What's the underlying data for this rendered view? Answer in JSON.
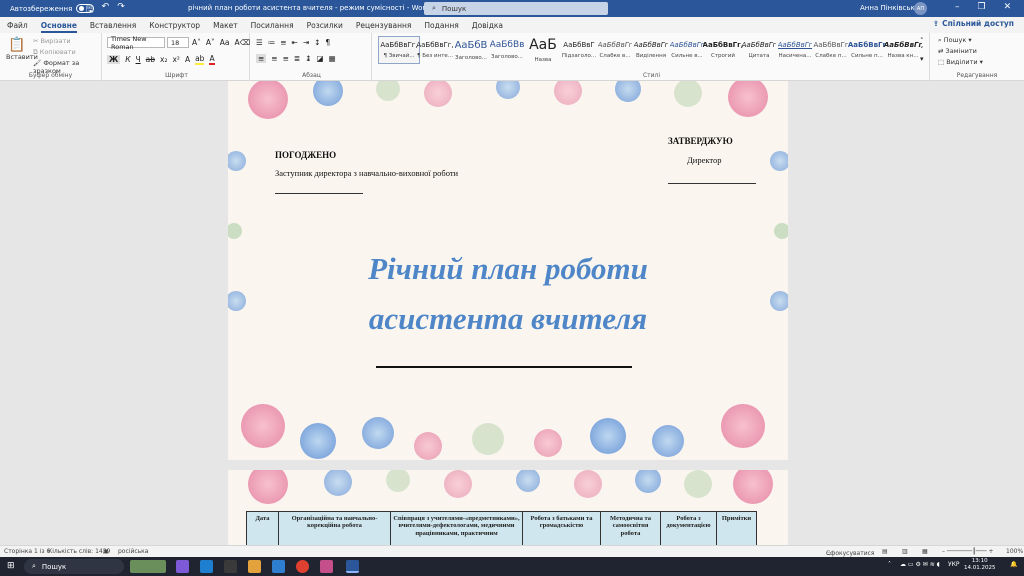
{
  "titlebar": {
    "autosave": "Автозбереження",
    "doc_title": "річний план роботи асистента вчителя  -  режим сумісності  -  Word",
    "search": "Пошук",
    "user": "Анна Пінківська",
    "avatar": "АП"
  },
  "menu": {
    "tabs": [
      "Файл",
      "Основне",
      "Вставлення",
      "Конструктор",
      "Макет",
      "Посилання",
      "Розсилки",
      "Рецензування",
      "Подання",
      "Довідка"
    ],
    "active": "Основне",
    "share": "Спільний доступ"
  },
  "ribbon": {
    "clipboard": {
      "label": "Буфер обміну",
      "paste": "Вставити",
      "cut": "Вирізати",
      "copy": "Копіювати",
      "format": "Формат за зразком"
    },
    "font": {
      "label": "Шрифт",
      "name": "Times New Roman",
      "size": "18"
    },
    "paragraph": {
      "label": "Абзац"
    },
    "styles": {
      "label": "Стилі",
      "items": [
        {
          "sample": "АаБбВвГг,",
          "name": "¶ Звичай..."
        },
        {
          "sample": "АаБбВвГг,",
          "name": "¶ Без инте..."
        },
        {
          "sample": "АаБбВ",
          "name": "Заголово..."
        },
        {
          "sample": "АаБбВв",
          "name": "Заголово..."
        },
        {
          "sample": "АаБ",
          "name": "Назва"
        },
        {
          "sample": "АаБбВвГ",
          "name": "Підзаголо..."
        },
        {
          "sample": "АаБбВвГг",
          "name": "Слабке в..."
        },
        {
          "sample": "АаБбВвГг",
          "name": "Виділення"
        },
        {
          "sample": "АаБбВвГг",
          "name": "Сильне в..."
        },
        {
          "sample": "АаБбВвГг,",
          "name": "Строгий"
        },
        {
          "sample": "АаБбВвГг",
          "name": "Цитата"
        },
        {
          "sample": "АаБбВвГг",
          "name": "Насичена..."
        },
        {
          "sample": "АаБбВвГг",
          "name": "Слабке п..."
        },
        {
          "sample": "АаБбВвГг",
          "name": "Сильне п..."
        },
        {
          "sample": "АаБбВвГг",
          "name": "Назва кн..."
        }
      ]
    },
    "editing": {
      "label": "Редагування",
      "find": "Пошук",
      "replace": "Замінити",
      "select": "Виділити"
    }
  },
  "document": {
    "approved": "ПОГОДЖЕНО",
    "approved_role": "Заступник директора з навчально-виховної роботи",
    "confirm": "ЗАТВЕРДЖУЮ",
    "confirm_role": "Директор",
    "title_line1": "Річний план роботи",
    "title_line2": "асистента вчителя",
    "table_headers": [
      "Дата",
      "Організаційна та навчально-корекційна робота",
      "Співпраця з учителями-«предметниками», вчителями-дефектологами, медичними працівниками, практичним",
      "Робота з батьками та громадськістю",
      "Методична та самоосвітня робота",
      "Робота з документацією",
      "Примітки"
    ]
  },
  "status": {
    "page": "Сторінка 1 із 6",
    "words": "Кількість слів: 1439",
    "lang": "російська",
    "focus": "Сфокусуватися",
    "zoom": "100%"
  },
  "taskbar": {
    "search": "Пошук",
    "lang": "УКР",
    "time": "13:10",
    "date": "14.01.2025"
  },
  "colors": {
    "accent": "#2b579a",
    "title_blue": "#4f86c8",
    "table_header": "#cfe6ee"
  }
}
